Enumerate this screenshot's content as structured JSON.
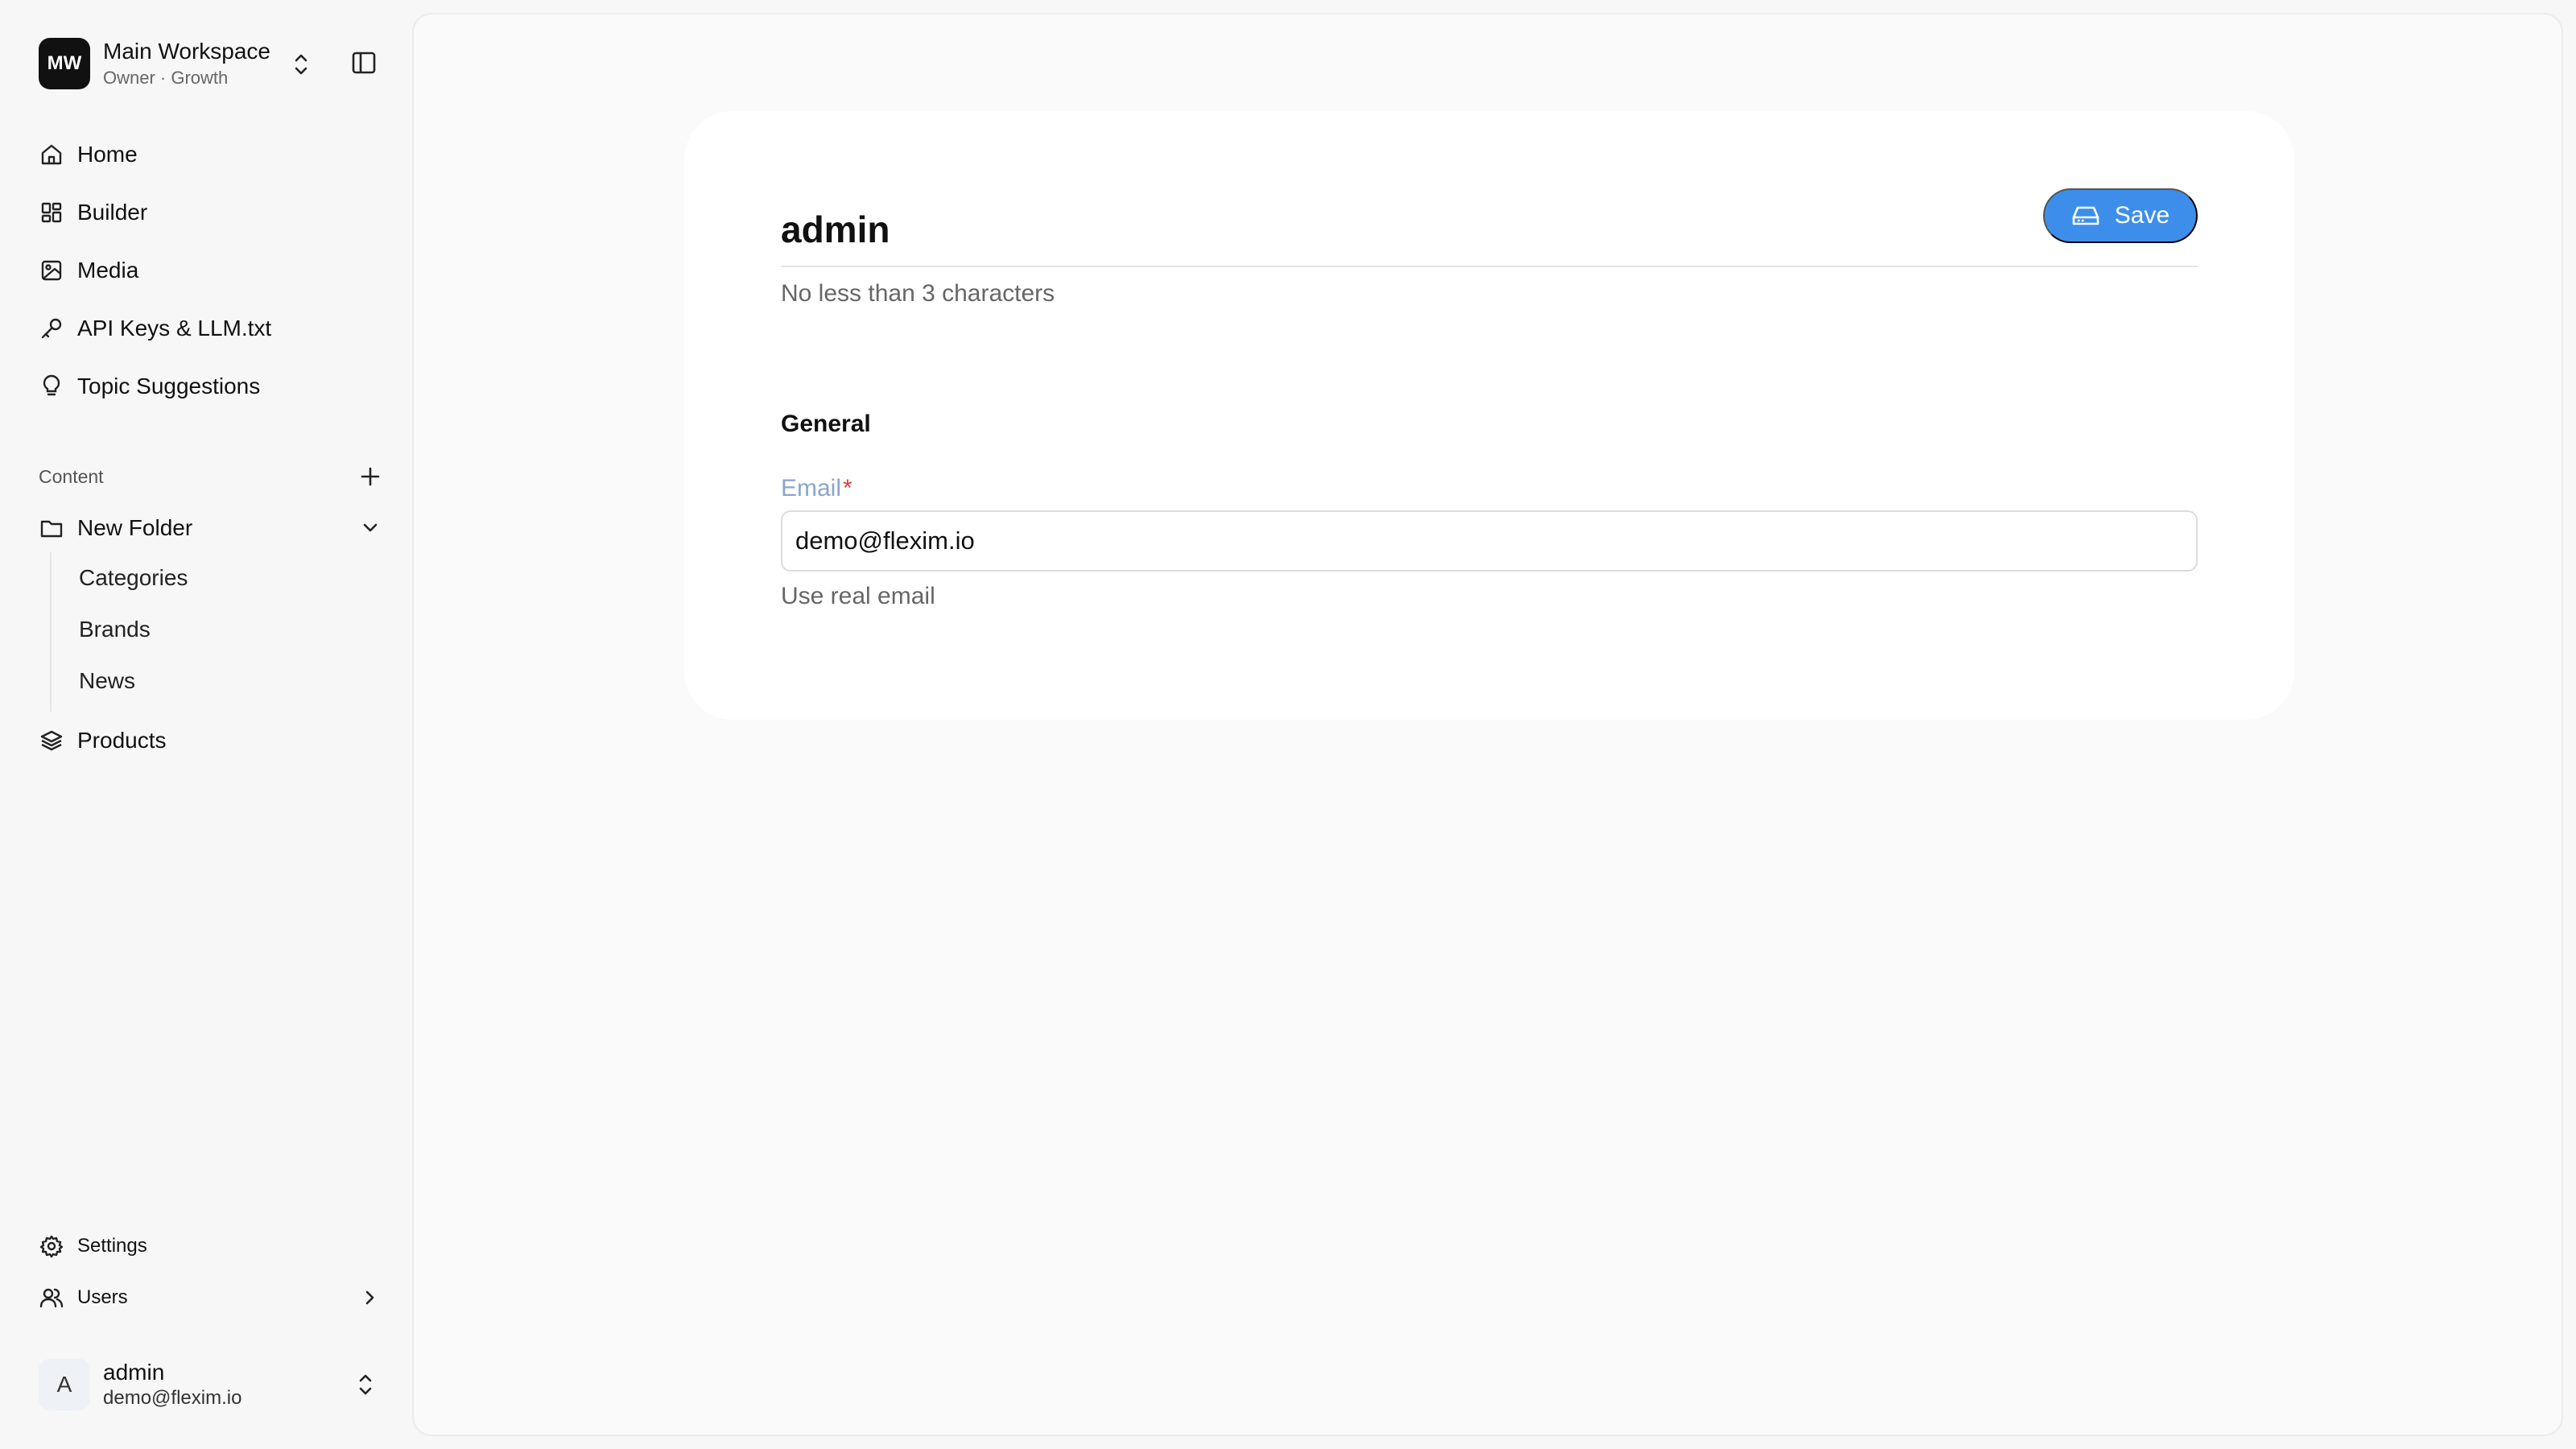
{
  "workspace": {
    "initials": "MW",
    "name": "Main Workspace",
    "subtitle": "Owner · Growth"
  },
  "nav": {
    "items": [
      {
        "label": "Home",
        "icon": "home-icon"
      },
      {
        "label": "Builder",
        "icon": "grid-icon"
      },
      {
        "label": "Media",
        "icon": "image-icon"
      },
      {
        "label": "API Keys & LLM.txt",
        "icon": "key-icon"
      },
      {
        "label": "Topic Suggestions",
        "icon": "lightbulb-icon"
      }
    ]
  },
  "content": {
    "label": "Content",
    "folder": {
      "label": "New Folder",
      "expanded": true
    },
    "sub_items": [
      "Categories",
      "Brands",
      "News"
    ],
    "products_label": "Products"
  },
  "bottom_nav": {
    "settings_label": "Settings",
    "users_label": "Users"
  },
  "user": {
    "initial": "A",
    "name": "admin",
    "email": "demo@flexim.io"
  },
  "form": {
    "title": "admin",
    "title_helper": "No less than 3 characters",
    "save_label": "Save",
    "section_title": "General",
    "email": {
      "label": "Email",
      "required_mark": "*",
      "value": "demo@flexim.io",
      "helper": "Use real email"
    }
  },
  "colors": {
    "accent": "#3d8eea",
    "required": "#e23c3c",
    "field_label": "#8aa6c8"
  }
}
